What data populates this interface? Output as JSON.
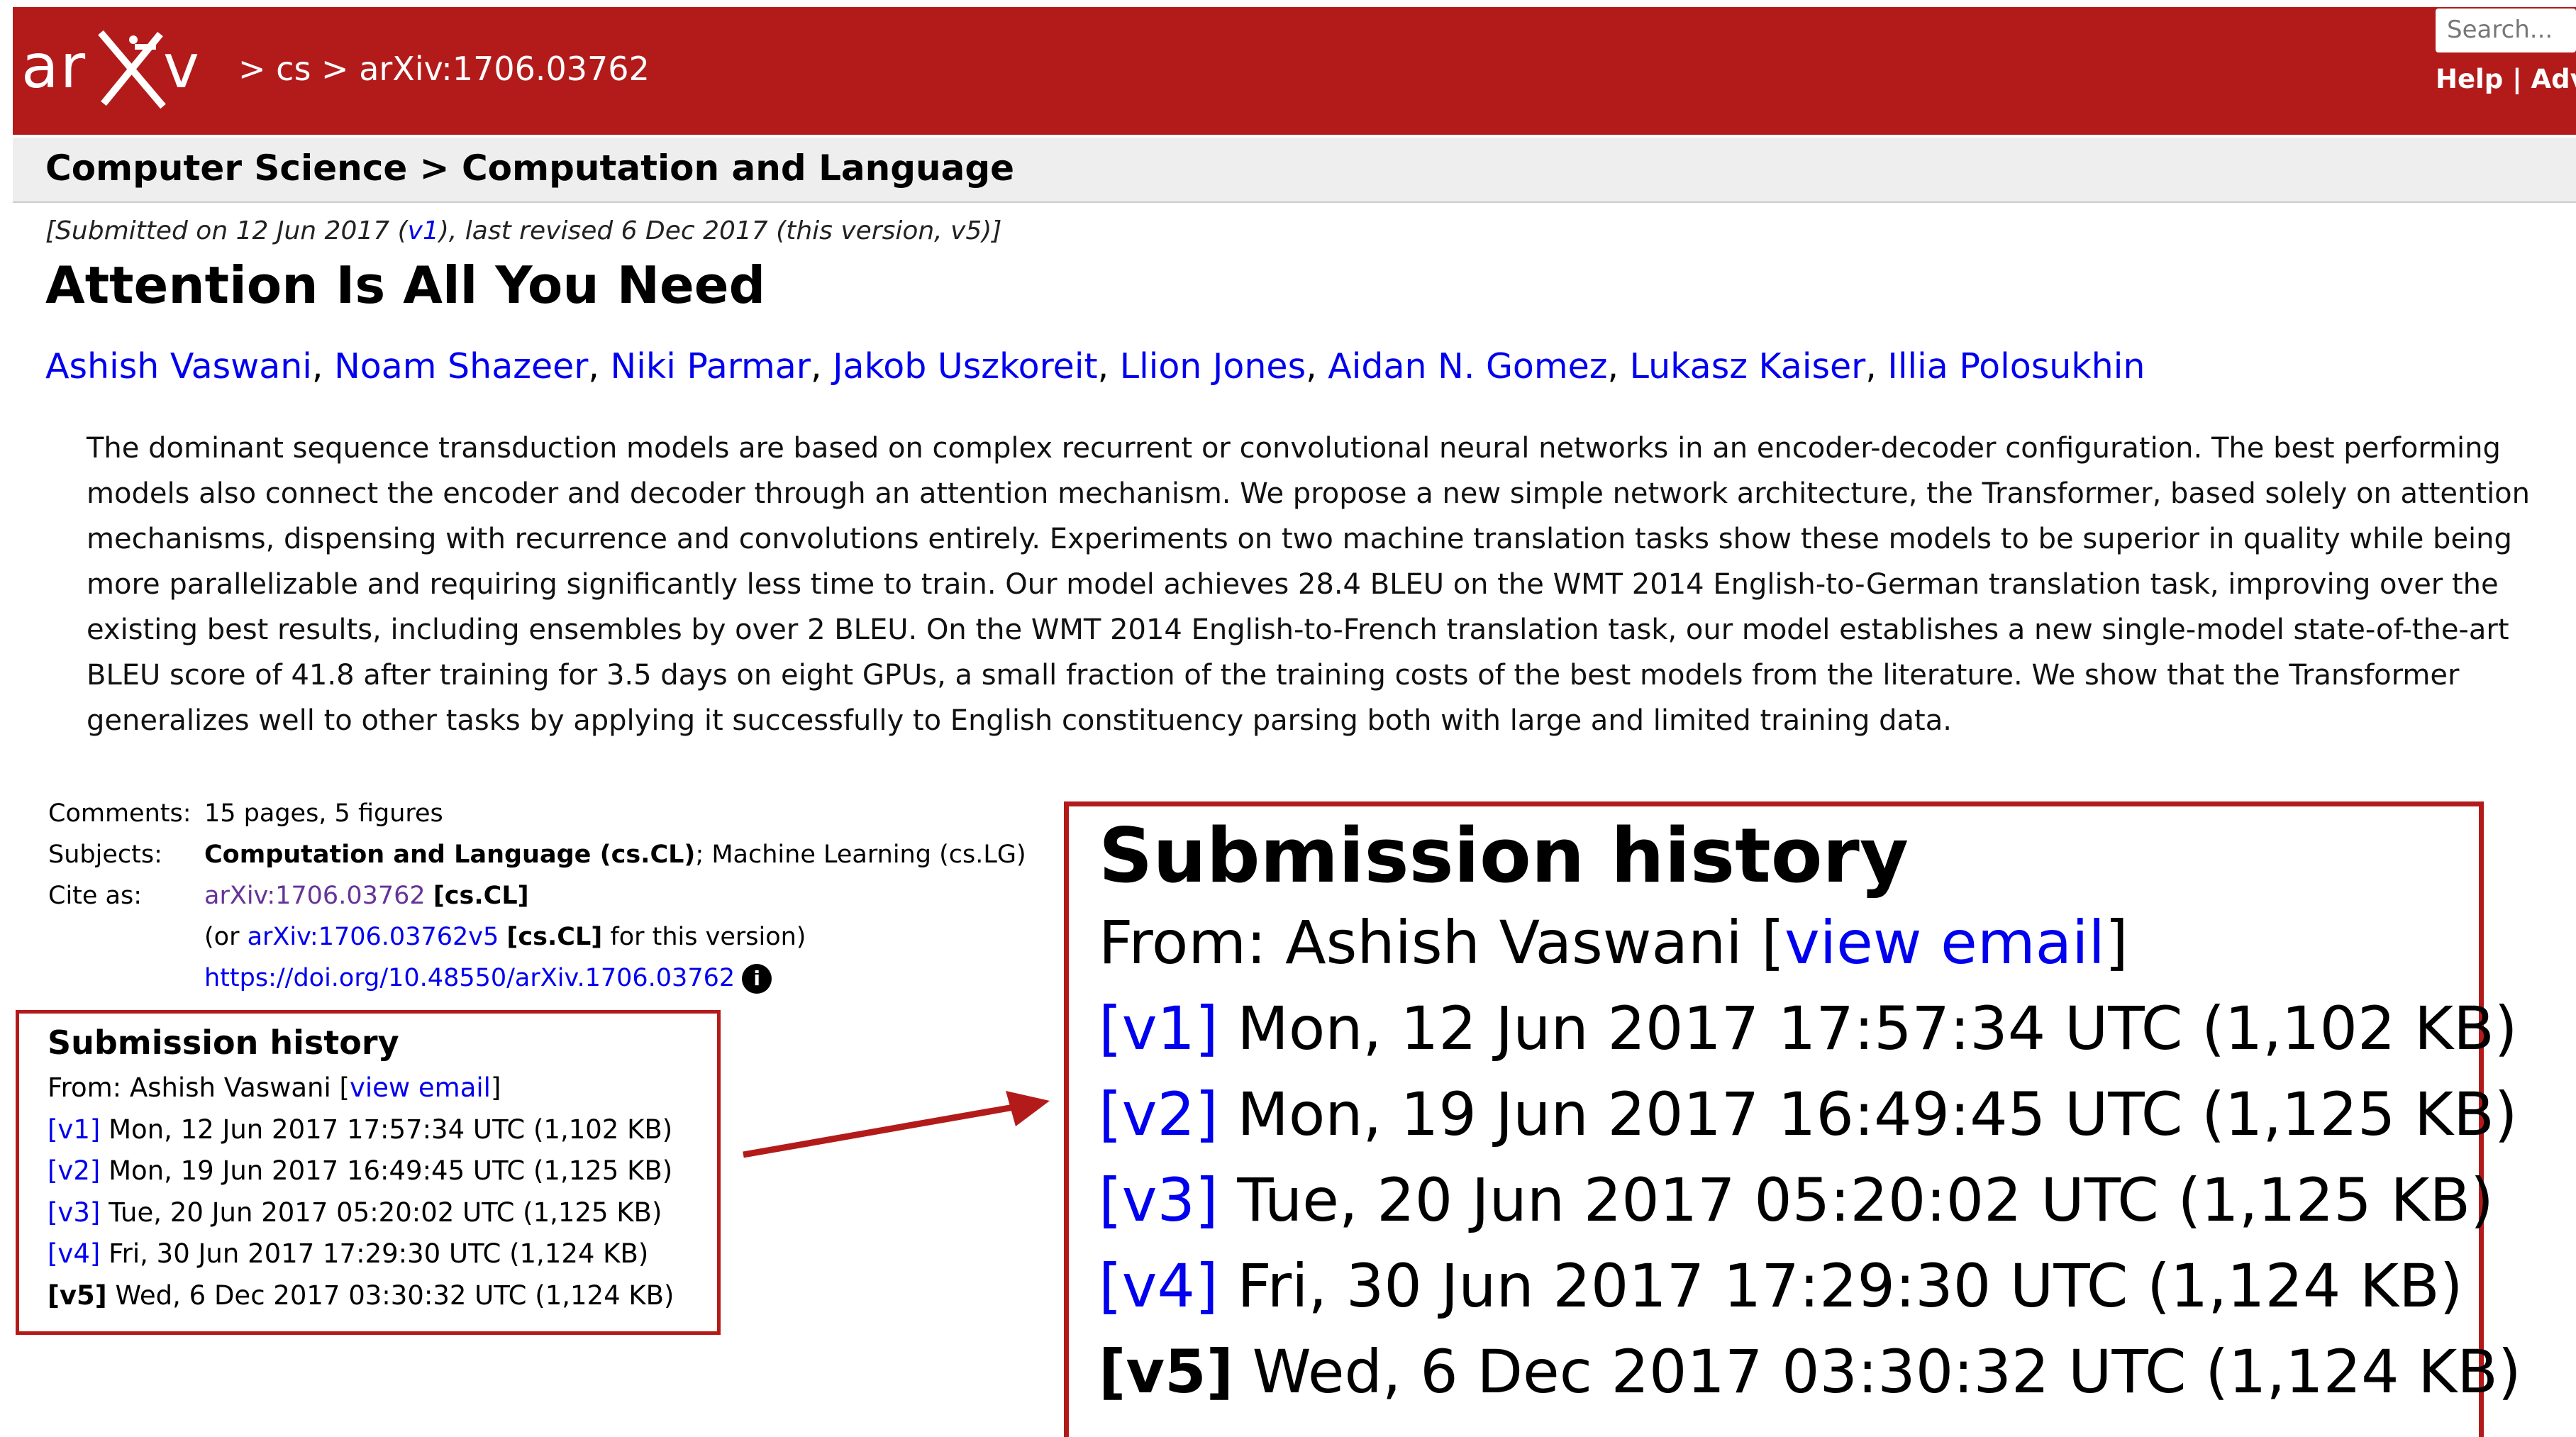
{
  "header": {
    "logo_text": "arXiv",
    "breadcrumb": "> cs > arXiv:1706.03762",
    "search_placeholder": "Search...",
    "help_label": "Help",
    "separator": "|",
    "advanced_label": "Adva",
    "brand_color": "#b31b1b"
  },
  "subheader": {
    "text": "Computer Science > Computation and Language"
  },
  "paper": {
    "dateline_prefix": "[Submitted on 12 Jun 2017 (",
    "dateline_v1": "v1",
    "dateline_suffix": "), last revised 6 Dec 2017 (this version, v5)]",
    "title": "Attention Is All You Need",
    "authors": [
      "Ashish Vaswani",
      "Noam Shazeer",
      "Niki Parmar",
      "Jakob Uszkoreit",
      "Llion Jones",
      "Aidan N. Gomez",
      "Lukasz Kaiser",
      "Illia Polosukhin"
    ],
    "abstract": "The dominant sequence transduction models are based on complex recurrent or convolutional neural networks in an encoder-decoder configuration. The best performing models also connect the encoder and decoder through an attention mechanism. We propose a new simple network architecture, the Transformer, based solely on attention mechanisms, dispensing with recurrence and convolutions entirely. Experiments on two machine translation tasks show these models to be superior in quality while being more parallelizable and requiring significantly less time to train. Our model achieves 28.4 BLEU on the WMT 2014 English-to-German translation task, improving over the existing best results, including ensembles by over 2 BLEU. On the WMT 2014 English-to-French translation task, our model establishes a new single-model state-of-the-art BLEU score of 41.8 after training for 3.5 days on eight GPUs, a small fraction of the training costs of the best models from the literature. We show that the Transformer generalizes well to other tasks by applying it successfully to English constituency parsing both with large and limited training data."
  },
  "metadata": {
    "comments_label": "Comments:",
    "comments_value": "15 pages, 5 figures",
    "subjects_label": "Subjects:",
    "subjects_primary": "Computation and Language (cs.CL)",
    "subjects_rest": "; Machine Learning (cs.LG)",
    "cite_label": "Cite as:",
    "cite_id": "arXiv:1706.03762",
    "cite_cat": "[cs.CL]",
    "cite_or_prefix": "(or ",
    "cite_version_id": "arXiv:1706.03762v5",
    "cite_version_cat": "[cs.CL]",
    "cite_or_suffix": " for this version)",
    "doi": "https://doi.org/10.48550/arXiv.1706.03762",
    "info_icon": "i"
  },
  "history": {
    "heading": "Submission history",
    "from_prefix": "From: Ashish Vaswani [",
    "view_email": "view email",
    "from_suffix": "]",
    "versions": [
      {
        "tag": "[v1]",
        "text": " Mon, 12 Jun 2017 17:57:34 UTC (1,102 KB)"
      },
      {
        "tag": "[v2]",
        "text": " Mon, 19 Jun 2017 16:49:45 UTC (1,125 KB)"
      },
      {
        "tag": "[v3]",
        "text": " Tue, 20 Jun 2017 05:20:02 UTC (1,125 KB)"
      },
      {
        "tag": "[v4]",
        "text": " Fri, 30 Jun 2017 17:29:30 UTC (1,124 KB)"
      },
      {
        "tag": "[v5]",
        "text": " Wed, 6 Dec 2017 03:30:32 UTC (1,124 KB)"
      }
    ]
  }
}
